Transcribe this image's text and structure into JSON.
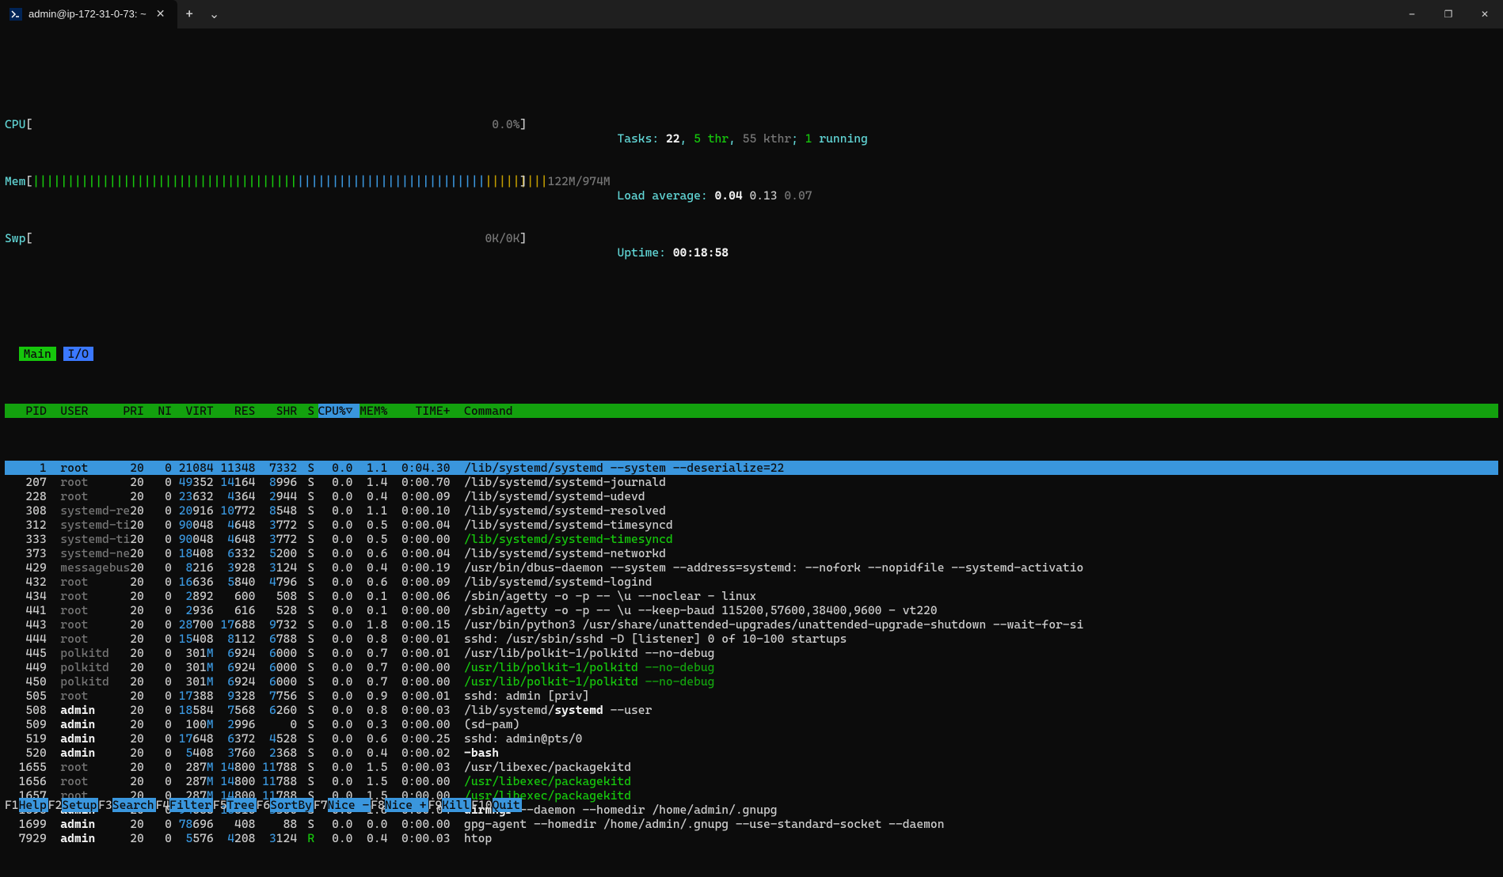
{
  "window": {
    "tab_title": "admin@ip-172-31-0-73: ~",
    "tab_icon": "powershell-icon",
    "new_tab": "+",
    "dropdown": "⌄",
    "minimize": "—",
    "maximize": "❐",
    "close": "✕"
  },
  "meters": {
    "cpu": {
      "label": "CPU",
      "bar": "",
      "value": "0.0%"
    },
    "mem": {
      "label": "Mem",
      "bar_green": "||||||||||||||||||||||||||||||||||||||",
      "bar_blue": "|||||||||||||||||||||||||||",
      "bar_yellow": "|||||||||",
      "value": "122M/974M"
    },
    "swp": {
      "label": "Swp",
      "bar": "",
      "value": "0K/0K"
    },
    "tasks": {
      "label": "Tasks: ",
      "total": "22",
      "sep1": ", ",
      "thr": "5",
      "thr_lbl": " thr",
      "sep2": ", ",
      "kthr": "55 kthr",
      "sep3": "; ",
      "running": "1",
      "running_lbl": " running"
    },
    "load": {
      "label": "Load average: ",
      "v1": "0.04",
      "v2": "0.13",
      "v3": "0.07"
    },
    "uptime": {
      "label": "Uptime: ",
      "value": "00:18:58"
    }
  },
  "tabs": {
    "main": "Main",
    "io": "I/O"
  },
  "columns": [
    "PID",
    "USER",
    "PRI",
    "NI",
    "VIRT",
    "RES",
    "SHR",
    "S",
    "CPU%▽",
    "MEM%",
    "TIME+",
    "Command"
  ],
  "processes": [
    {
      "pid": "1",
      "user": "root",
      "pri": "20",
      "ni": "0",
      "virt": "21084",
      "res": "11348",
      "shr": "7332",
      "s": "S",
      "cpu": "0.0",
      "mem": "1.1",
      "time": "0:04.30",
      "cmd": "/lib/systemd/systemd --system --deserialize=22",
      "selected": true,
      "seg": [
        {
          "t": "/lib/systemd/systemd --system --deserialize=22"
        }
      ]
    },
    {
      "pid": "207",
      "user": "root",
      "pri": "20",
      "ni": "0",
      "virt": "49352",
      "res": "14164",
      "shr": "8996",
      "s": "S",
      "cpu": "0.0",
      "mem": "1.4",
      "time": "0:00.70",
      "seg": [
        {
          "t": "/lib/systemd/systemd-journald"
        }
      ]
    },
    {
      "pid": "228",
      "user": "root",
      "pri": "20",
      "ni": "0",
      "virt": "23632",
      "res": "4364",
      "shr": "2944",
      "s": "S",
      "cpu": "0.0",
      "mem": "0.4",
      "time": "0:00.09",
      "seg": [
        {
          "t": "/lib/systemd/systemd-udevd"
        }
      ]
    },
    {
      "pid": "308",
      "user": "systemd-re",
      "pri": "20",
      "ni": "0",
      "virt": "20916",
      "res": "10772",
      "shr": "8548",
      "s": "S",
      "cpu": "0.0",
      "mem": "1.1",
      "time": "0:00.10",
      "seg": [
        {
          "t": "/lib/systemd/systemd-resolved"
        }
      ]
    },
    {
      "pid": "312",
      "user": "systemd-ti",
      "pri": "20",
      "ni": "0",
      "virt": "90048",
      "res": "4648",
      "shr": "3772",
      "s": "S",
      "cpu": "0.0",
      "mem": "0.5",
      "time": "0:00.04",
      "seg": [
        {
          "t": "/lib/systemd/systemd-timesyncd"
        }
      ]
    },
    {
      "pid": "333",
      "user": "systemd-ti",
      "pri": "20",
      "ni": "0",
      "virt": "90048",
      "res": "4648",
      "shr": "3772",
      "s": "S",
      "cpu": "0.0",
      "mem": "0.5",
      "time": "0:00.00",
      "seg": [
        {
          "t": "/lib/systemd/systemd-timesyncd",
          "c": "green-b"
        }
      ]
    },
    {
      "pid": "373",
      "user": "systemd-ne",
      "pri": "20",
      "ni": "0",
      "virt": "18408",
      "res": "6332",
      "shr": "5200",
      "s": "S",
      "cpu": "0.0",
      "mem": "0.6",
      "time": "0:00.04",
      "seg": [
        {
          "t": "/lib/systemd/systemd-networkd"
        }
      ]
    },
    {
      "pid": "429",
      "user": "messagebus",
      "pri": "20",
      "ni": "0",
      "virt": "8216",
      "res": "3928",
      "shr": "3124",
      "s": "S",
      "cpu": "0.0",
      "mem": "0.4",
      "time": "0:00.19",
      "seg": [
        {
          "t": "/usr/bin/dbus-daemon --system --address=systemd: --nofork --nopidfile --systemd-activatio"
        }
      ]
    },
    {
      "pid": "432",
      "user": "root",
      "pri": "20",
      "ni": "0",
      "virt": "16636",
      "res": "5840",
      "shr": "4796",
      "s": "S",
      "cpu": "0.0",
      "mem": "0.6",
      "time": "0:00.09",
      "seg": [
        {
          "t": "/lib/systemd/systemd-logind"
        }
      ]
    },
    {
      "pid": "434",
      "user": "root",
      "pri": "20",
      "ni": "0",
      "virt": "2892",
      "res": "600",
      "shr": "508",
      "s": "S",
      "cpu": "0.0",
      "mem": "0.1",
      "time": "0:00.06",
      "seg": [
        {
          "t": "/sbin/agetty -o -p -- \\u --noclear - linux"
        }
      ]
    },
    {
      "pid": "441",
      "user": "root",
      "pri": "20",
      "ni": "0",
      "virt": "2936",
      "res": "616",
      "shr": "528",
      "s": "S",
      "cpu": "0.0",
      "mem": "0.1",
      "time": "0:00.00",
      "seg": [
        {
          "t": "/sbin/agetty -o -p -- \\u --keep-baud 115200,57600,38400,9600 - vt220"
        }
      ]
    },
    {
      "pid": "443",
      "user": "root",
      "pri": "20",
      "ni": "0",
      "virt": "28700",
      "res": "17688",
      "shr": "9732",
      "s": "S",
      "cpu": "0.0",
      "mem": "1.8",
      "time": "0:00.15",
      "seg": [
        {
          "t": "/usr/bin/python3 /usr/share/unattended-upgrades/unattended-upgrade-shutdown --wait-for-si"
        }
      ]
    },
    {
      "pid": "444",
      "user": "root",
      "pri": "20",
      "ni": "0",
      "virt": "15408",
      "res": "8112",
      "shr": "6788",
      "s": "S",
      "cpu": "0.0",
      "mem": "0.8",
      "time": "0:00.01",
      "seg": [
        {
          "t": "sshd: /usr/sbin/sshd -D [listener] 0 of 10-100 startups"
        }
      ]
    },
    {
      "pid": "445",
      "user": "polkitd",
      "pri": "20",
      "ni": "0",
      "virt": "301M",
      "res": "6924",
      "shr": "6000",
      "s": "S",
      "cpu": "0.0",
      "mem": "0.7",
      "time": "0:00.01",
      "seg": [
        {
          "t": "/usr/lib/polkit-1/polkitd --no-debug"
        }
      ]
    },
    {
      "pid": "449",
      "user": "polkitd",
      "pri": "20",
      "ni": "0",
      "virt": "301M",
      "res": "6924",
      "shr": "6000",
      "s": "S",
      "cpu": "0.0",
      "mem": "0.7",
      "time": "0:00.00",
      "seg": [
        {
          "t": "/usr/lib/polkit-1/polkitd ",
          "c": "green-b"
        },
        {
          "t": "--no-debug",
          "c": "green"
        }
      ]
    },
    {
      "pid": "450",
      "user": "polkitd",
      "pri": "20",
      "ni": "0",
      "virt": "301M",
      "res": "6924",
      "shr": "6000",
      "s": "S",
      "cpu": "0.0",
      "mem": "0.7",
      "time": "0:00.00",
      "seg": [
        {
          "t": "/usr/lib/polkit-1/polkitd ",
          "c": "green-b"
        },
        {
          "t": "--no-debug",
          "c": "green"
        }
      ]
    },
    {
      "pid": "505",
      "user": "root",
      "pri": "20",
      "ni": "0",
      "virt": "17388",
      "res": "9328",
      "shr": "7756",
      "s": "S",
      "cpu": "0.0",
      "mem": "0.9",
      "time": "0:00.01",
      "seg": [
        {
          "t": "sshd: admin [priv]"
        }
      ]
    },
    {
      "pid": "508",
      "user": "admin",
      "pri": "20",
      "ni": "0",
      "virt": "18584",
      "res": "7568",
      "shr": "6260",
      "s": "S",
      "cpu": "0.0",
      "mem": "0.8",
      "time": "0:00.03",
      "seg": [
        {
          "t": "/lib/systemd/",
          "c": "white"
        },
        {
          "t": "systemd",
          "c": "bold"
        },
        {
          "t": " --user",
          "c": "white"
        }
      ]
    },
    {
      "pid": "509",
      "user": "admin",
      "pri": "20",
      "ni": "0",
      "virt": "100M",
      "res": "2996",
      "shr": "0",
      "s": "S",
      "cpu": "0.0",
      "mem": "0.3",
      "time": "0:00.00",
      "seg": [
        {
          "t": "(sd-pam)"
        }
      ]
    },
    {
      "pid": "519",
      "user": "admin",
      "pri": "20",
      "ni": "0",
      "virt": "17648",
      "res": "6372",
      "shr": "4528",
      "s": "S",
      "cpu": "0.0",
      "mem": "0.6",
      "time": "0:00.25",
      "seg": [
        {
          "t": "sshd: admin@pts/0"
        }
      ]
    },
    {
      "pid": "520",
      "user": "admin",
      "pri": "20",
      "ni": "0",
      "virt": "5408",
      "res": "3760",
      "shr": "2368",
      "s": "S",
      "cpu": "0.0",
      "mem": "0.4",
      "time": "0:00.02",
      "seg": [
        {
          "t": "-bash",
          "c": "bold"
        }
      ]
    },
    {
      "pid": "1655",
      "user": "root",
      "pri": "20",
      "ni": "0",
      "virt": "287M",
      "res": "14800",
      "shr": "11788",
      "s": "S",
      "cpu": "0.0",
      "mem": "1.5",
      "time": "0:00.03",
      "seg": [
        {
          "t": "/usr/libexec/packagekitd"
        }
      ]
    },
    {
      "pid": "1656",
      "user": "root",
      "pri": "20",
      "ni": "0",
      "virt": "287M",
      "res": "14800",
      "shr": "11788",
      "s": "S",
      "cpu": "0.0",
      "mem": "1.5",
      "time": "0:00.00",
      "seg": [
        {
          "t": "/usr/libexec/packagekitd",
          "c": "green-b"
        }
      ]
    },
    {
      "pid": "1657",
      "user": "root",
      "pri": "20",
      "ni": "0",
      "virt": "287M",
      "res": "14800",
      "shr": "11788",
      "s": "S",
      "cpu": "0.0",
      "mem": "1.5",
      "time": "0:00.00",
      "seg": [
        {
          "t": "/usr/libexec/packagekitd",
          "c": "green-b"
        }
      ]
    },
    {
      "pid": "1696",
      "user": "admin",
      "pri": "20",
      "ni": "0",
      "virt": "94688",
      "res": "15616",
      "shr": "3300",
      "s": "S",
      "cpu": "0.0",
      "mem": "1.6",
      "time": "0:00.04",
      "seg": [
        {
          "t": "dirmngr",
          "c": "bold"
        },
        {
          "t": " --daemon --homedir /home/admin/.gnupg",
          "c": "white"
        }
      ]
    },
    {
      "pid": "1699",
      "user": "admin",
      "pri": "20",
      "ni": "0",
      "virt": "78696",
      "res": "408",
      "shr": "88",
      "s": "S",
      "cpu": "0.0",
      "mem": "0.0",
      "time": "0:00.00",
      "seg": [
        {
          "t": "gpg-agent --homedir /home/admin/.gnupg --use-standard-socket --daemon"
        }
      ]
    },
    {
      "pid": "7929",
      "user": "admin",
      "pri": "20",
      "ni": "0",
      "virt": "5576",
      "res": "4208",
      "shr": "3124",
      "s": "R",
      "cpu": "0.0",
      "mem": "0.4",
      "time": "0:00.03",
      "seg": [
        {
          "t": "htop"
        }
      ]
    }
  ],
  "footer": [
    {
      "k": "F1",
      "a": "Help  "
    },
    {
      "k": "F2",
      "a": "Setup "
    },
    {
      "k": "F3",
      "a": "Search"
    },
    {
      "k": "F4",
      "a": "Filter"
    },
    {
      "k": "F5",
      "a": "Tree  "
    },
    {
      "k": "F6",
      "a": "SortBy"
    },
    {
      "k": "F7",
      "a": "Nice -"
    },
    {
      "k": "F8",
      "a": "Nice +"
    },
    {
      "k": "F9",
      "a": "Kill  "
    },
    {
      "k": "F10",
      "a": "Quit  "
    }
  ]
}
